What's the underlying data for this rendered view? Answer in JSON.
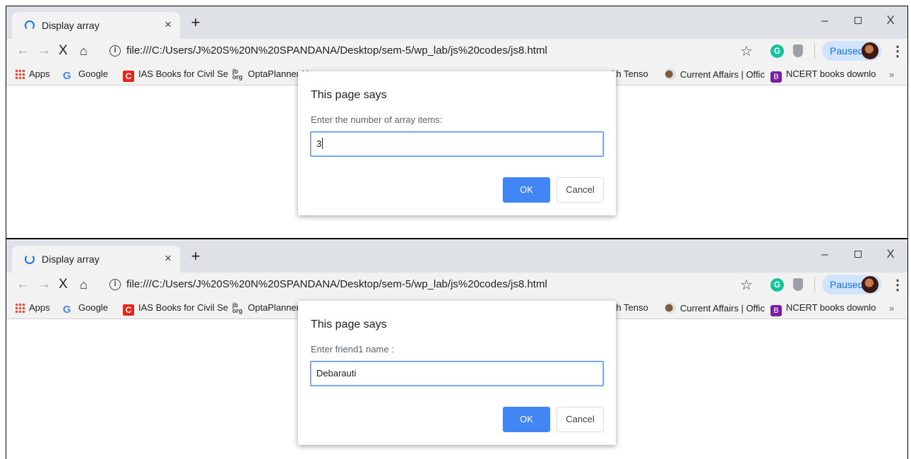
{
  "browser": {
    "tab_title": "Display array",
    "tab_close": "×",
    "new_tab": "+",
    "window_controls": {
      "minimize": "–",
      "close": "X"
    },
    "nav": {
      "back": "←",
      "forward": "→",
      "stop": "X",
      "home": "⌂"
    },
    "info_icon": "i",
    "url": "file:///C:/Users/J%20S%20N%20SPANDANA/Desktop/sem-5/wp_lab/js%20codes/js8.html",
    "star": "☆",
    "grammarly": "G",
    "profile_status": "Paused",
    "menu": "⋮",
    "bookmarks": [
      {
        "label": "Apps",
        "icon": "apps-icon"
      },
      {
        "label": "Google",
        "icon": "google-icon"
      },
      {
        "label": "IAS Books for Civil Se",
        "icon": "c-icon"
      },
      {
        "label": "OptaPlanner U",
        "icon": "jboss-org-icon"
      },
      {
        "label": "ith Tenso",
        "icon": ""
      },
      {
        "label": "Current Affairs | Offic",
        "icon": "current-affairs-icon"
      },
      {
        "label": "NCERT books downlo",
        "icon": "ncert-icon"
      }
    ],
    "bookmarks_more": "»",
    "google_glyph": "G",
    "c_glyph": "C",
    "org_glyph": "jboss\n.org",
    "ncert_glyph": "B"
  },
  "dialogs": [
    {
      "title": "This page says",
      "message": "Enter the number of array items:",
      "value": "3",
      "ok": "OK",
      "cancel": "Cancel"
    },
    {
      "title": "This page says",
      "message": "Enter friend1 name :",
      "value": "Debarauti",
      "ok": "OK",
      "cancel": "Cancel"
    }
  ],
  "colors": {
    "accent": "#4285f4",
    "tab_strip": "#dee1e6",
    "toolbar": "#f2f2f2",
    "paused_pill": "#d2e3fc"
  }
}
